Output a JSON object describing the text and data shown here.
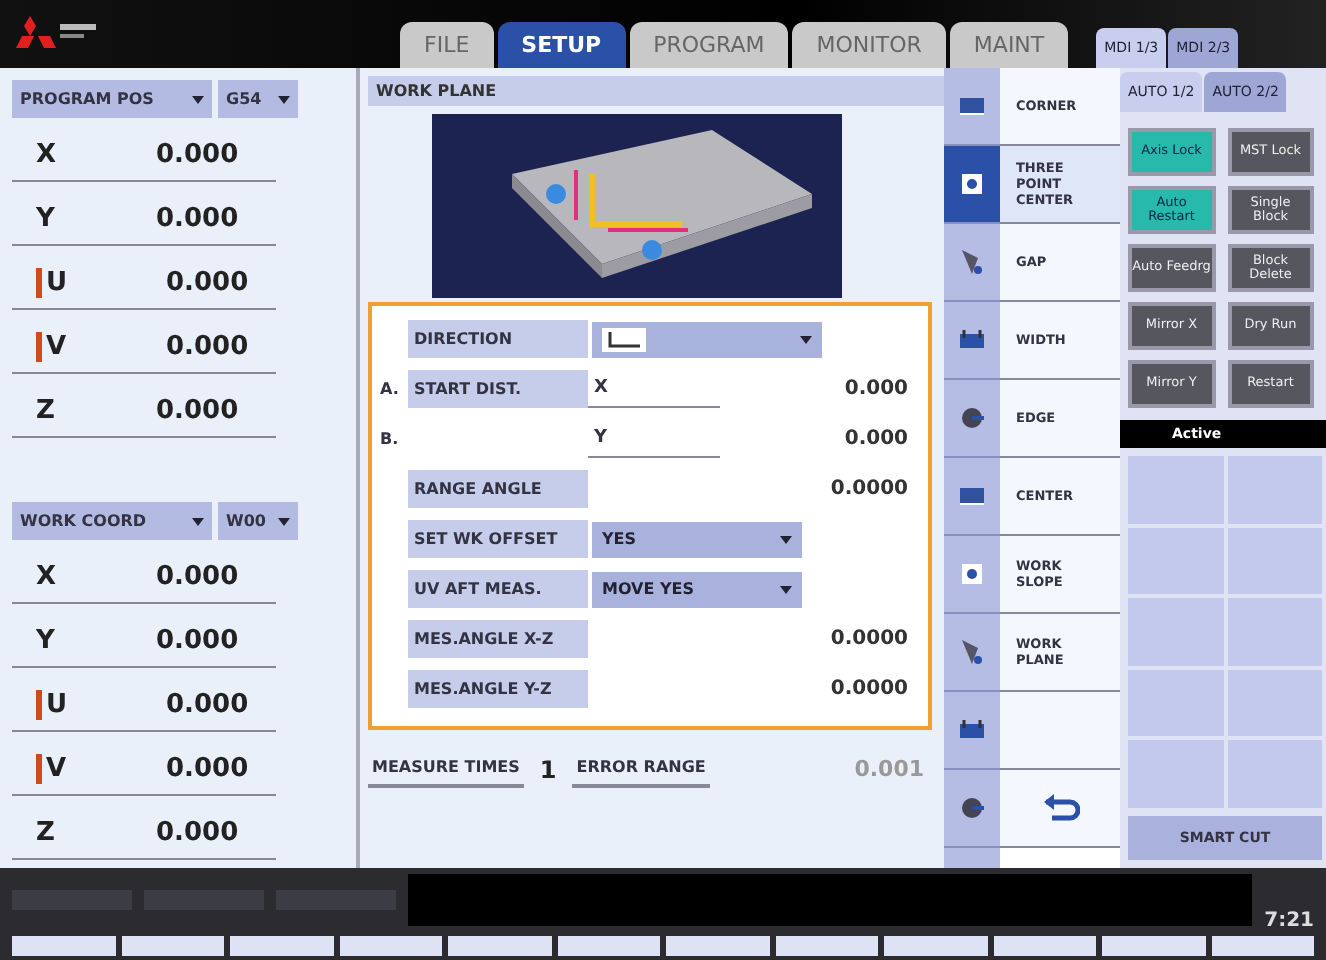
{
  "main_tabs": [
    {
      "label": "FILE",
      "selected": false
    },
    {
      "label": "SETUP",
      "selected": true
    },
    {
      "label": "PROGRAM",
      "selected": false
    },
    {
      "label": "MONITOR",
      "selected": false
    },
    {
      "label": "MAINT",
      "selected": false
    }
  ],
  "mode_tabs": [
    {
      "label": "MDI 1/3",
      "selected": true
    },
    {
      "label": "MDI 2/3",
      "selected": false
    }
  ],
  "sub_tabs": [
    {
      "label": "AUTO 1/2",
      "selected": true
    },
    {
      "label": "AUTO 2/2",
      "selected": false
    }
  ],
  "position_panels": [
    {
      "mode": "PROGRAM POS",
      "coord": "G54",
      "axes": [
        {
          "name": "X",
          "value": "0.000",
          "marked": false
        },
        {
          "name": "Y",
          "value": "0.000",
          "marked": false
        },
        {
          "name": "U",
          "value": "0.000",
          "marked": true
        },
        {
          "name": "V",
          "value": "0.000",
          "marked": true
        },
        {
          "name": "Z",
          "value": "0.000",
          "marked": false
        }
      ]
    },
    {
      "mode": "WORK COORD",
      "coord": "W00",
      "axes": [
        {
          "name": "X",
          "value": "0.000",
          "marked": false
        },
        {
          "name": "Y",
          "value": "0.000",
          "marked": false
        },
        {
          "name": "U",
          "value": "0.000",
          "marked": true
        },
        {
          "name": "V",
          "value": "0.000",
          "marked": true
        },
        {
          "name": "Z",
          "value": "0.000",
          "marked": false
        }
      ]
    }
  ],
  "work_plane": {
    "title": "WORK PLANE",
    "fields": [
      {
        "kind": "icon_select",
        "label": "DIRECTION"
      },
      {
        "kind": "axis",
        "prefix": "A.",
        "label": "START DIST.",
        "axis": "X",
        "value": "0.000"
      },
      {
        "kind": "axis",
        "prefix": "B.",
        "axis": "Y",
        "value": "0.000"
      },
      {
        "kind": "value",
        "label": "RANGE ANGLE",
        "value": "0.0000"
      },
      {
        "kind": "select",
        "label": "SET WK OFFSET",
        "value": "YES"
      },
      {
        "kind": "select",
        "label": "UV AFT MEAS.",
        "value": "MOVE YES"
      },
      {
        "kind": "value",
        "label": "MES.ANGLE X-Z",
        "value": "0.0000"
      },
      {
        "kind": "value",
        "label": "MES.ANGLE Y-Z",
        "value": "0.0000"
      }
    ],
    "measure_times": {
      "label": "MEASURE TIMES",
      "value": "1"
    },
    "error_range": {
      "label": "ERROR RANGE",
      "value": "0.001"
    }
  },
  "menu": [
    {
      "kind": "text",
      "label": "CORNER",
      "selected": false
    },
    {
      "kind": "text",
      "label": "THREE POINT CENTER",
      "selected": true
    },
    {
      "kind": "text",
      "label": "GAP",
      "selected": false
    },
    {
      "kind": "text",
      "label": "WIDTH",
      "selected": false
    },
    {
      "kind": "text",
      "label": "EDGE",
      "selected": false
    },
    {
      "kind": "text",
      "label": "CENTER",
      "selected": false
    },
    {
      "kind": "text",
      "label": "WORK SLOPE",
      "selected": false
    },
    {
      "kind": "text",
      "label": "WORK PLANE",
      "selected": false
    },
    {
      "kind": "blank",
      "selected": false
    },
    {
      "kind": "return",
      "selected": false
    }
  ],
  "toggles": [
    {
      "label": "Axis Lock",
      "on": true
    },
    {
      "label": "MST Lock",
      "on": false
    },
    {
      "label": "Auto Restart",
      "on": true
    },
    {
      "label": "Single Block",
      "on": false
    },
    {
      "label": "Auto Feedrg",
      "on": false
    },
    {
      "label": "Block Delete",
      "on": false
    },
    {
      "label": "Mirror X",
      "on": false
    },
    {
      "label": "Dry Run",
      "on": false
    },
    {
      "label": "Mirror Y",
      "on": false
    },
    {
      "label": "Restart",
      "on": false
    }
  ],
  "active_list": {
    "title": "Active"
  },
  "smart_cut": "SMART CUT",
  "status": {
    "time": "7:21"
  }
}
